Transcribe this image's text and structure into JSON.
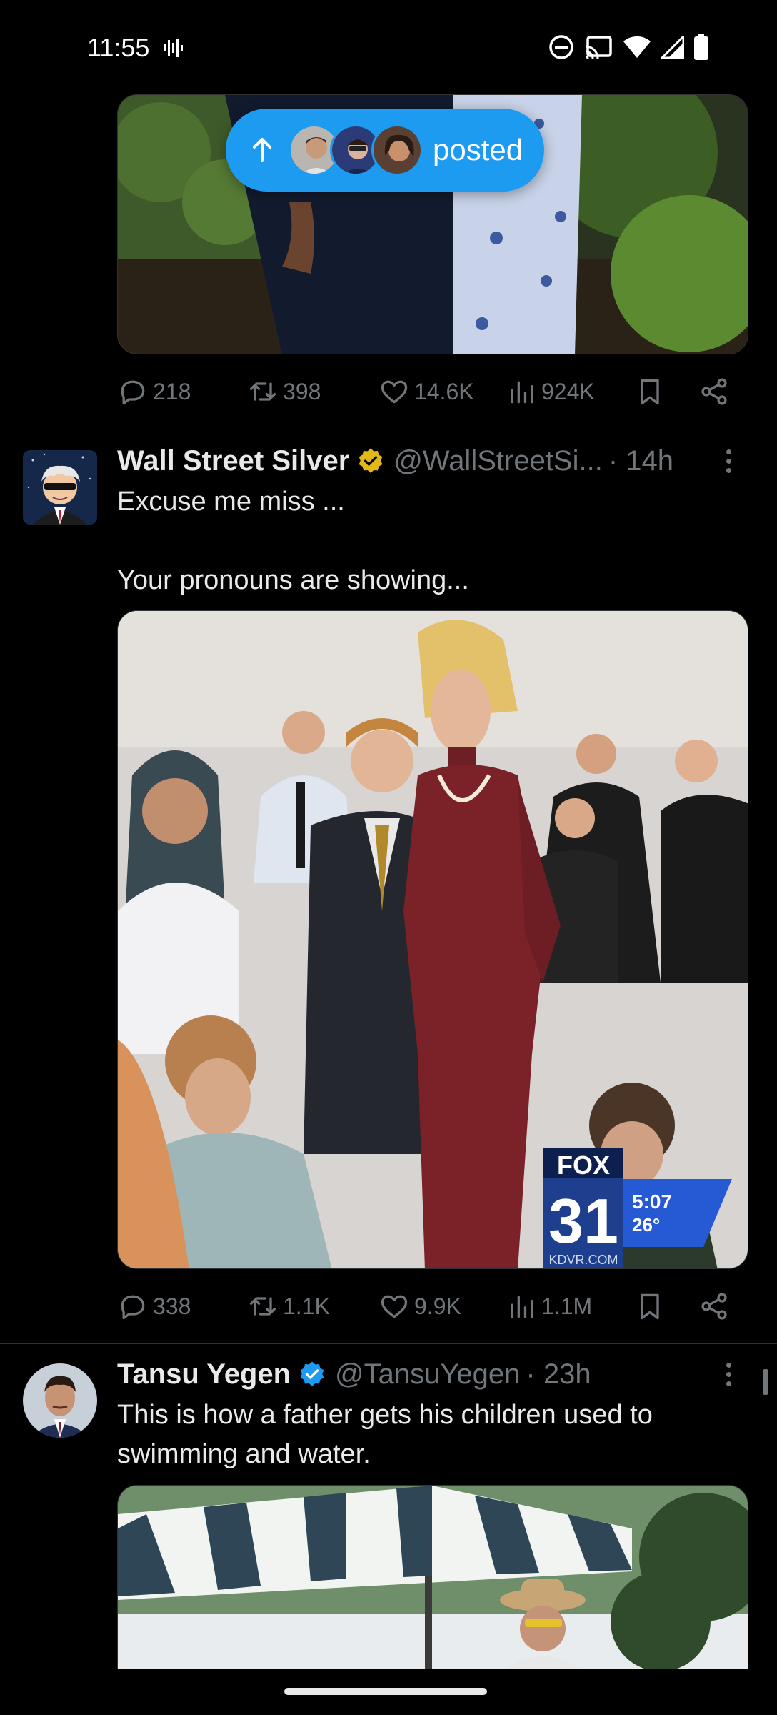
{
  "status_bar": {
    "time": "11:55",
    "icons": [
      "voice-wave-icon",
      "do-not-disturb-icon",
      "cast-icon",
      "wifi-icon",
      "signal-icon",
      "battery-icon"
    ]
  },
  "new_posts_pill": {
    "label": "posted",
    "icon": "arrow-up-icon"
  },
  "tweets": [
    {
      "actions": {
        "replies": "218",
        "reposts": "398",
        "likes": "14.6K",
        "views": "924K"
      }
    },
    {
      "author": "Wall Street Silver",
      "handle": "@WallStreetSi...",
      "time": "· 14h",
      "text": "Excuse me miss ...\n\nYour pronouns are showing...",
      "media_overlay": {
        "channel": "FOX",
        "number": "31",
        "clock": "5:07",
        "temp": "26°",
        "station": "KDVR.COM"
      },
      "actions": {
        "replies": "338",
        "reposts": "1.1K",
        "likes": "9.9K",
        "views": "1.1M"
      }
    },
    {
      "author": "Tansu Yegen",
      "handle": "@TansuYegen",
      "time": "· 23h",
      "text": "This is how a father gets his children used to swimming and water."
    }
  ],
  "colors": {
    "accent": "#1d9bf0",
    "muted": "#71767b",
    "verified_gold": "#e2b719",
    "background": "#000000"
  }
}
